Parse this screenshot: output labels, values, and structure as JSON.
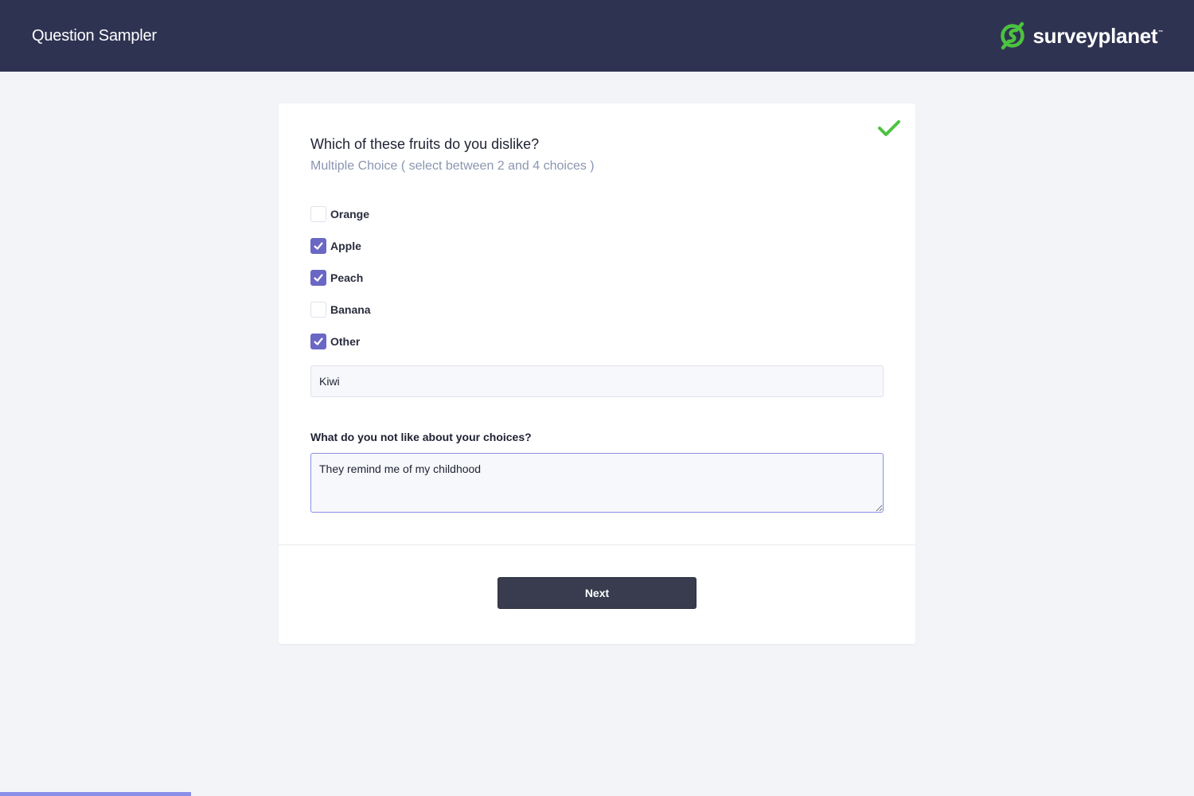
{
  "header": {
    "title": "Question Sampler",
    "brand": {
      "name": "surveyplanet",
      "trademark": "™",
      "icon": "surveyplanet-logo-icon",
      "color": "#4cc23f"
    },
    "background": "#2f3352"
  },
  "question": {
    "status_icon": "checkmark-icon",
    "status_color": "#4cc23f",
    "title": "Which of these fruits do you dislike?",
    "subtitle": "Multiple Choice ( select between 2 and 4 choices )",
    "options": [
      {
        "label": "Orange",
        "checked": false
      },
      {
        "label": "Apple",
        "checked": true
      },
      {
        "label": "Peach",
        "checked": true
      },
      {
        "label": "Banana",
        "checked": false
      },
      {
        "label": "Other",
        "checked": true
      }
    ],
    "other_input": {
      "value": "Kiwi",
      "placeholder": ""
    },
    "followup": {
      "label": "What do you not like about your choices?",
      "value": "They remind me of my childhood"
    },
    "accent_color": "#6b67c4"
  },
  "footer": {
    "next_label": "Next"
  },
  "progress": {
    "percent": 16,
    "color": "#8b8fe8"
  }
}
